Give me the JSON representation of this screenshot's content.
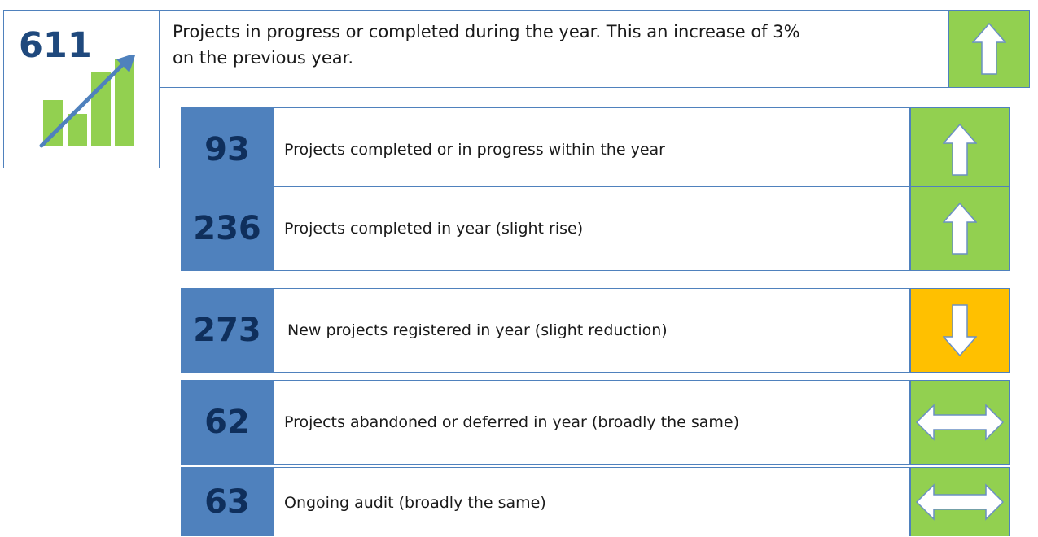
{
  "summary": {
    "number": "611",
    "headline": "Projects in progress or completed during the year. This an increase of 3% on the previous year.",
    "trend": "up",
    "trend_icon": "arrow-up-icon",
    "trend_color": "#92d050",
    "icon": "growth-chart-icon"
  },
  "stats": [
    {
      "number": "93",
      "label": "Projects completed or in progress within the year",
      "trend": "up",
      "trend_icon": "arrow-up-icon",
      "trend_color": "#92d050"
    },
    {
      "number": "236",
      "label": "Projects completed in year (slight rise)",
      "trend": "up",
      "trend_icon": "arrow-up-icon",
      "trend_color": "#92d050"
    },
    {
      "number": "273",
      "label": "New projects registered in year (slight reduction)",
      "trend": "down",
      "trend_icon": "arrow-down-icon",
      "trend_color": "#ffc000"
    },
    {
      "number": "62",
      "label": "Projects abandoned or deferred in year (broadly the same)",
      "trend": "same",
      "trend_icon": "arrow-left-right-icon",
      "trend_color": "#92d050"
    },
    {
      "number": "63",
      "label": "Ongoing audit (broadly the same)",
      "trend": "same",
      "trend_icon": "arrow-left-right-icon",
      "trend_color": "#92d050"
    }
  ],
  "colors": {
    "number_box": "#4f81bd",
    "number_text": "#1f497d",
    "border": "#4f81bd",
    "up": "#92d050",
    "down": "#ffc000"
  }
}
